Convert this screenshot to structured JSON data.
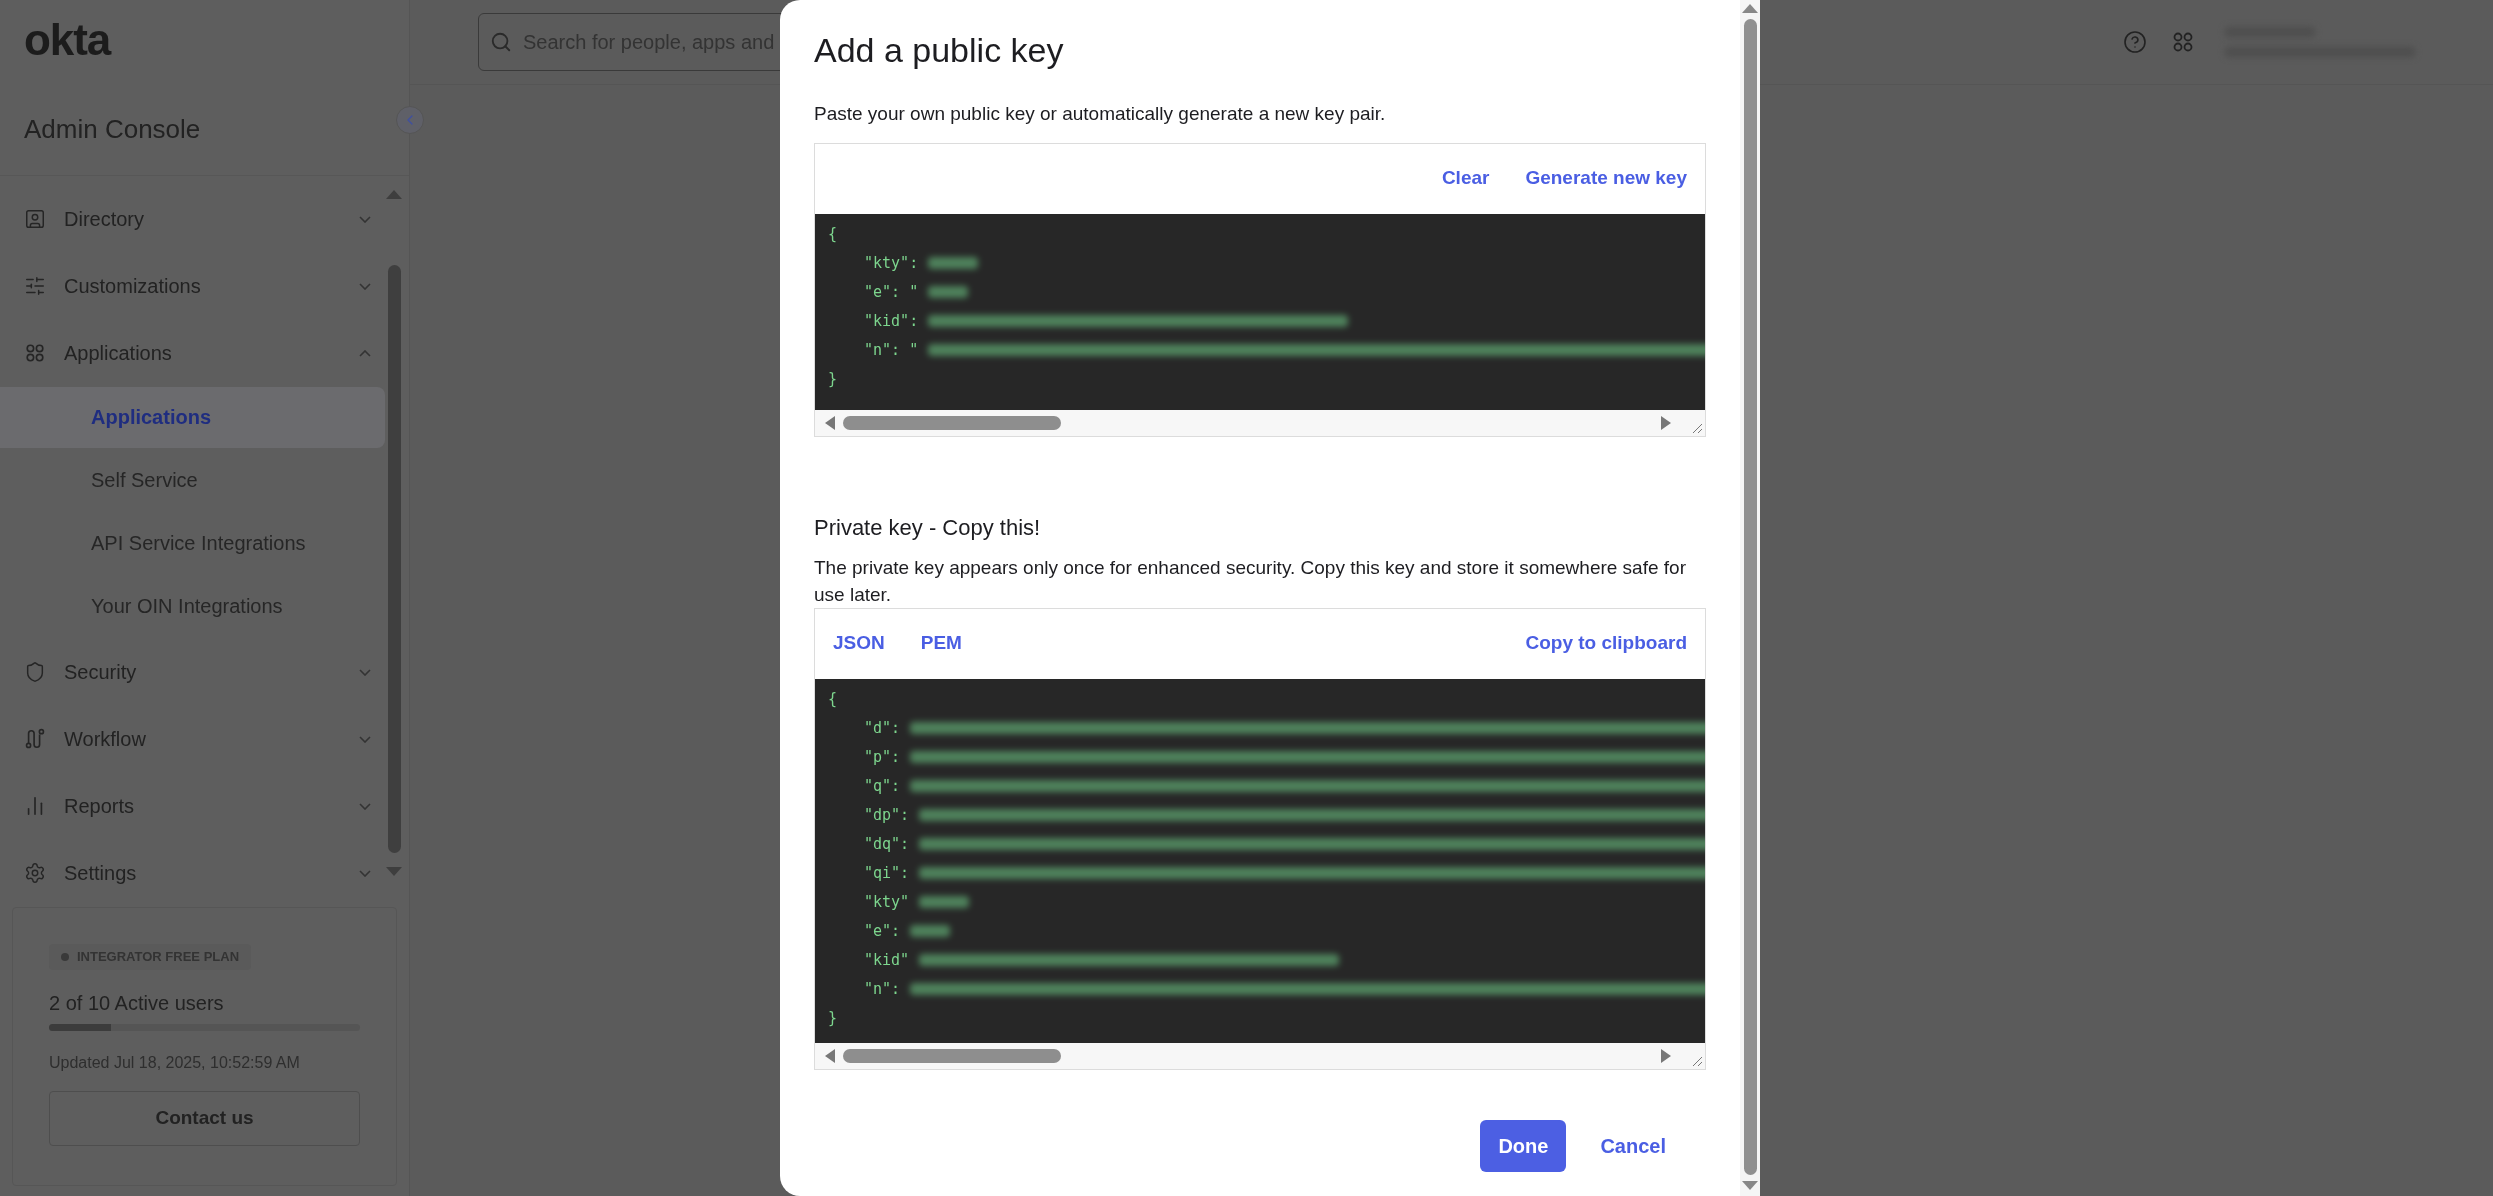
{
  "sidebar": {
    "logo": "okta",
    "title": "Admin Console",
    "items": [
      {
        "label": "Directory",
        "expanded": false
      },
      {
        "label": "Customizations",
        "expanded": false
      },
      {
        "label": "Applications",
        "expanded": true,
        "children": [
          {
            "label": "Applications",
            "selected": true
          },
          {
            "label": "Self Service",
            "selected": false
          },
          {
            "label": "API Service Integrations",
            "selected": false
          },
          {
            "label": "Your OIN Integrations",
            "selected": false
          }
        ]
      },
      {
        "label": "Security",
        "expanded": false
      },
      {
        "label": "Workflow",
        "expanded": false
      },
      {
        "label": "Reports",
        "expanded": false
      },
      {
        "label": "Settings",
        "expanded": false
      }
    ],
    "plan": {
      "badge": "INTEGRATOR FREE PLAN",
      "users": "2 of 10 Active users",
      "level": 0.2,
      "updated": "Updated Jul 18, 2025, 10:52:59 AM",
      "button": "Contact us"
    }
  },
  "header": {
    "search": {
      "placeholder": "Search for people, apps and"
    }
  },
  "modal": {
    "title": "Add a public key",
    "description": "Paste your own public key or automatically generate a new key pair.",
    "public_key": {
      "actions": [
        "Clear",
        "Generate new key"
      ],
      "lines": [
        {
          "text": "{"
        },
        {
          "text": "\"kty\":",
          "redacted": true
        },
        {
          "text": "\"e\": \"",
          "redacted": true
        },
        {
          "text": "\"kid\":",
          "redacted": true
        },
        {
          "text": "\"n\": \"",
          "redacted": true
        },
        {
          "text": "}"
        }
      ]
    },
    "private_key": {
      "heading": "Private key - Copy this!",
      "description": "The private key appears only once for enhanced security. Copy this key and store it somewhere safe for use later.",
      "formats": [
        {
          "label": "JSON"
        },
        {
          "label": "PEM"
        }
      ],
      "copy": "Copy to clipboard",
      "lines": [
        {
          "text": "{"
        },
        {
          "text": "\"d\":",
          "redacted": true
        },
        {
          "text": "\"p\":",
          "redacted": true
        },
        {
          "text": "\"q\":",
          "redacted": true
        },
        {
          "text": "\"dp\":",
          "redacted": true
        },
        {
          "text": "\"dq\":",
          "redacted": true
        },
        {
          "text": "\"qi\":",
          "redacted": true
        },
        {
          "text": "\"kty\"",
          "redacted": true
        },
        {
          "text": "\"e\":",
          "redacted": true
        },
        {
          "text": "\"kid\"",
          "redacted": true
        },
        {
          "text": "\"n\":",
          "redacted": true
        },
        {
          "text": "}"
        }
      ]
    },
    "buttons": {
      "done": "Done",
      "cancel": "Cancel"
    }
  }
}
